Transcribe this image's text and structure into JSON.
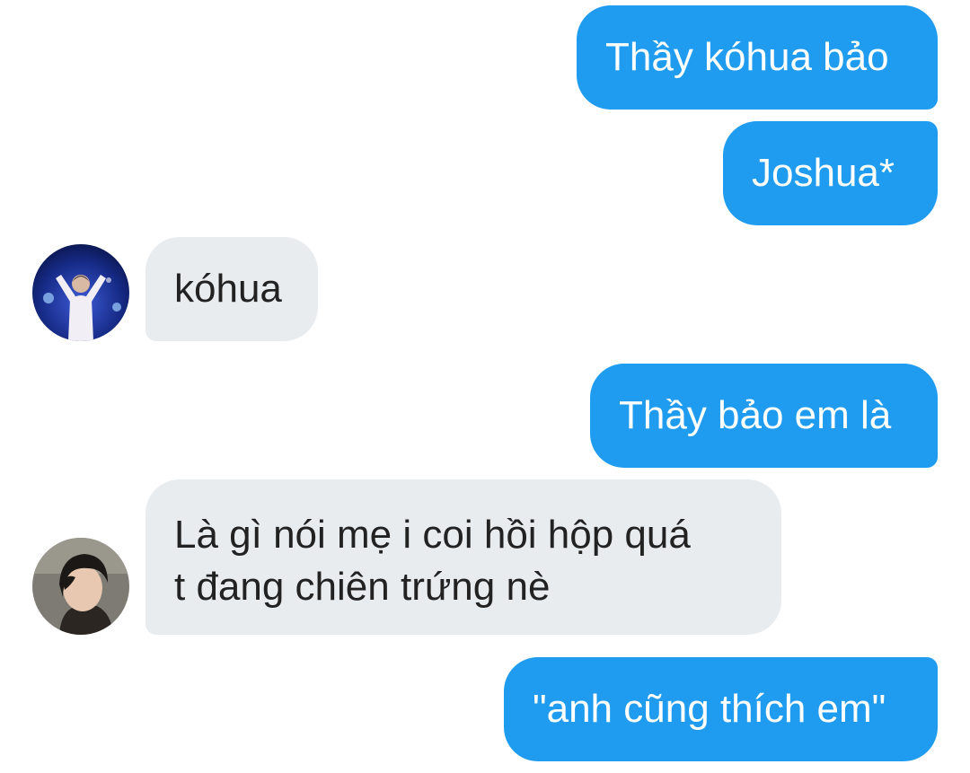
{
  "messages": [
    {
      "direction": "outgoing",
      "text": "Thầy kóhua bảo"
    },
    {
      "direction": "outgoing",
      "text": "Joshua*"
    },
    {
      "direction": "incoming",
      "text": "kóhua",
      "avatar": "avatar-1"
    },
    {
      "direction": "outgoing",
      "text": "Thầy bảo em là"
    },
    {
      "direction": "incoming",
      "lines": [
        "Là gì nói mẹ i coi hồi hộp quá",
        "t đang chiên trứng nè"
      ],
      "avatar": "avatar-2"
    },
    {
      "direction": "outgoing",
      "text": "\"anh cũng thích em\""
    }
  ],
  "colors": {
    "outgoing_bubble": "#1f9cef",
    "incoming_bubble": "#e9ecef",
    "outgoing_text": "#ffffff",
    "incoming_text": "#222222",
    "background": "#ffffff"
  }
}
